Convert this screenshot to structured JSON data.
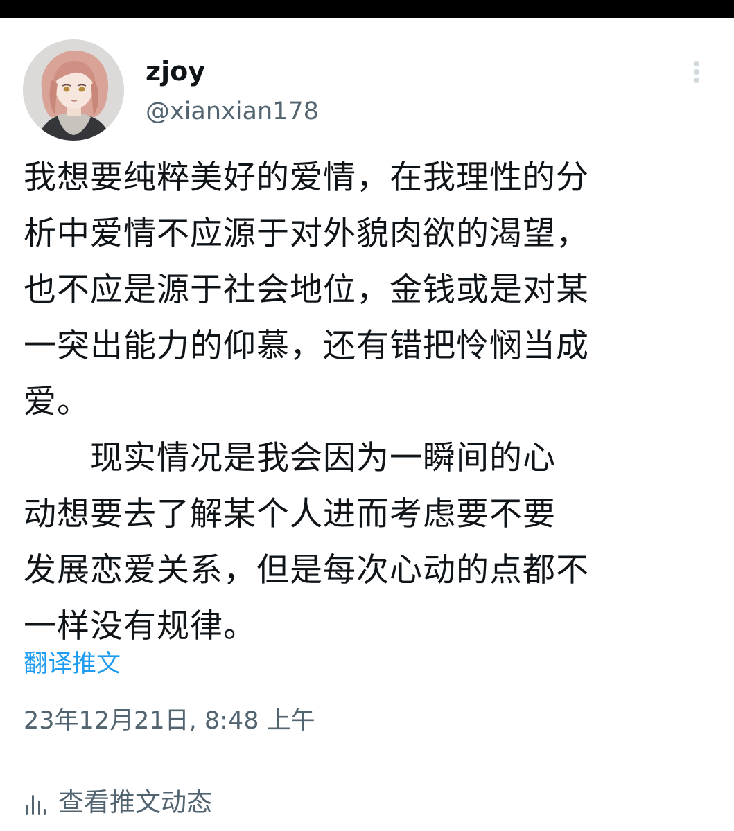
{
  "tweet": {
    "author": {
      "display_name": "zjoy",
      "handle": "@xianxian178"
    },
    "text": "我想要纯粹美好的爱情，在我理性的分\n析中爱情不应源于对外貌肉欲的渴望，\n也不应是源于社会地位，金钱或是对某\n一突出能力的仰慕，还有错把怜悯当成\n爱。\n　　现实情况是我会因为一瞬间的心\n动想要去了解某个人进而考虑要不要\n发展恋爱关系，但是每次心动的点都不\n一样没有规律。",
    "translate_label": "翻译推文",
    "timestamp": "23年12月21日, 8:48 上午",
    "activity_label": "查看推文动态"
  },
  "icons": {
    "more": "more-vertical-icon",
    "activity": "bar-chart-icon"
  },
  "colors": {
    "text_primary": "#0f1419",
    "text_secondary": "#536471",
    "link": "#1d9bf0"
  }
}
